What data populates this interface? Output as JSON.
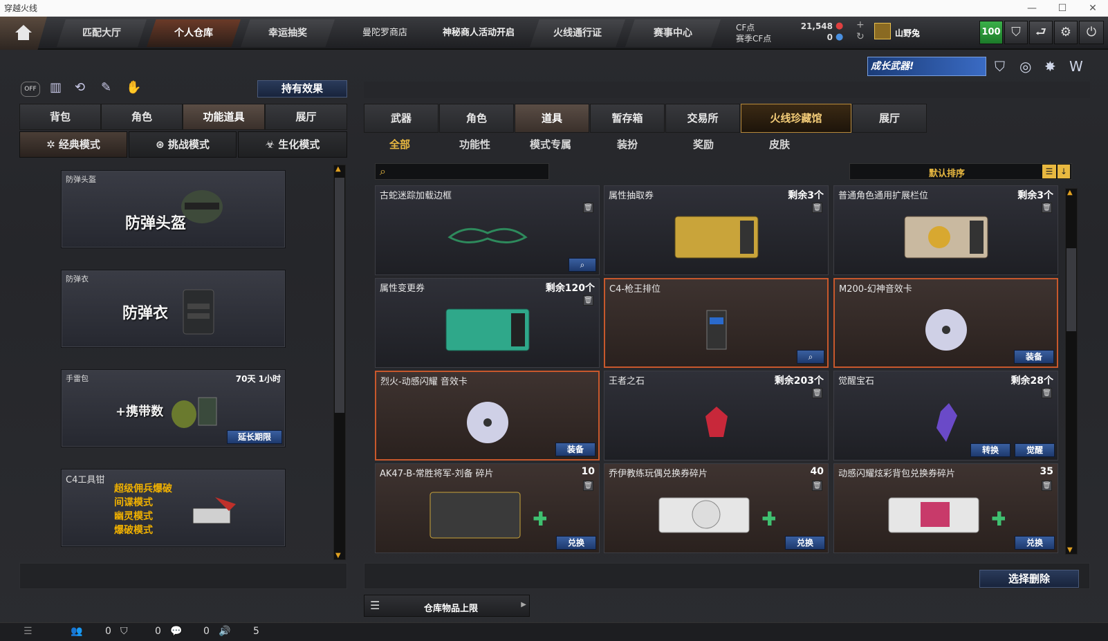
{
  "window": {
    "title": "穿越火线"
  },
  "nav": {
    "tabs": [
      {
        "label": "匹配大厅"
      },
      {
        "label": "个人仓库"
      },
      {
        "label": "幸运抽奖"
      },
      {
        "label": "曼陀罗商店"
      },
      {
        "label": "神秘商人活动开启"
      },
      {
        "label": "火线通行证"
      },
      {
        "label": "赛事中心"
      }
    ],
    "cf_label": "CF点",
    "season_cf_label": "赛季CF点",
    "cf_value": "21,548",
    "season_cf_value": "0",
    "username": "山野兔",
    "level": "100"
  },
  "banner": {
    "growth_weapon": "成长武器!"
  },
  "left": {
    "effect_button": "持有效果",
    "tabs": [
      {
        "label": "背包"
      },
      {
        "label": "角色"
      },
      {
        "label": "功能道具"
      },
      {
        "label": "展厅"
      }
    ],
    "modes": [
      {
        "label": "经典模式"
      },
      {
        "label": "挑战模式"
      },
      {
        "label": "生化模式"
      }
    ],
    "items": [
      {
        "name": "防弹头盔",
        "big": "防弹头盔",
        "time": ""
      },
      {
        "name": "防弹衣",
        "big": "防弹衣",
        "time": ""
      },
      {
        "name": "手雷包",
        "big": "+携带数",
        "time": "70天 1小时",
        "button": "延长期限"
      },
      {
        "name": "C4工具钳",
        "lines": [
          "超级佣兵爆破",
          "间谍模式",
          "幽灵模式",
          "爆破模式"
        ]
      }
    ]
  },
  "right": {
    "tabs": [
      {
        "label": "武器"
      },
      {
        "label": "角色"
      },
      {
        "label": "道具"
      },
      {
        "label": "暂存箱"
      },
      {
        "label": "交易所"
      },
      {
        "label": "火线珍藏馆"
      },
      {
        "label": "展厅"
      }
    ],
    "subtabs": [
      {
        "label": "全部"
      },
      {
        "label": "功能性"
      },
      {
        "label": "模式专属"
      },
      {
        "label": "装扮"
      },
      {
        "label": "奖励"
      },
      {
        "label": "皮肤"
      }
    ],
    "search_placeholder": "",
    "sort_label": "默认排序",
    "items": [
      {
        "name": "古蛇迷踪加载边框",
        "count": "",
        "button": ""
      },
      {
        "name": "属性抽取券",
        "count": "剩余3个",
        "button": ""
      },
      {
        "name": "普通角色通用扩展栏位",
        "count": "剩余3个",
        "button": ""
      },
      {
        "name": "属性变更券",
        "count": "剩余120个",
        "button": ""
      },
      {
        "name": "C4-枪王排位",
        "count": "",
        "button": ""
      },
      {
        "name": "M200-幻神音效卡",
        "count": "",
        "button": "装备"
      },
      {
        "name": "烈火-动感闪耀 音效卡",
        "count": "",
        "button": "装备"
      },
      {
        "name": "王者之石",
        "count": "剩余203个",
        "button": ""
      },
      {
        "name": "觉醒宝石",
        "count": "剩余28个",
        "button": "转换",
        "button2": "觉醒"
      },
      {
        "name": "AK47-B-常胜将军-刘备 碎片",
        "count": "10",
        "button": "兑换"
      },
      {
        "name": "乔伊教练玩偶兑换券碎片",
        "count": "40",
        "button": "兑换"
      },
      {
        "name": "动感闪耀炫彩背包兑换券碎片",
        "count": "35",
        "button": "兑换"
      }
    ],
    "delete_button": "选择删除",
    "capacity_label": "仓库物品上限"
  },
  "statusbar": {
    "v1": "0",
    "v2": "0",
    "v3": "0",
    "v4": "5"
  }
}
